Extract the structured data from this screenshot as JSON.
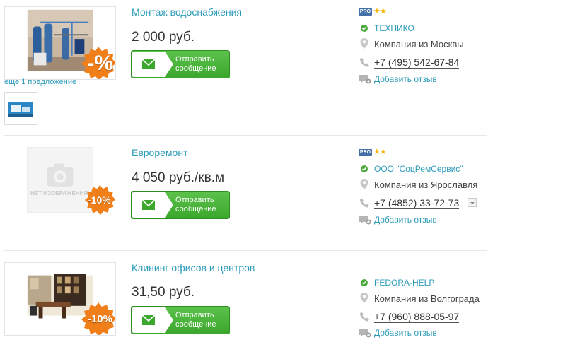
{
  "listings": [
    {
      "title": "Монтаж водоснабжения",
      "price": "2 000 руб.",
      "discount": "-%",
      "send_button": "Отправить\nсообщение",
      "more_offers": "еще 1 предложение",
      "pro_badge": "PRO",
      "company": "ТЕХНИКО",
      "city": "Компания из Москвы",
      "phone": "+7 (495) 542-67-84",
      "review_link": "Добавить отзыв"
    },
    {
      "title": "Евроремонт",
      "price": "4 050 руб./кв.м",
      "discount": "-10%",
      "no_image_text": "НЕТ ИЗОБРАЖЕНИЯ",
      "send_button": "Отправить\nсообщение",
      "pro_badge": "PRO",
      "company": "ООО \"СоцРемСервис\"",
      "city": "Компания из Ярославля",
      "phone": "+7 (4852) 33-72-73",
      "review_link": "Добавить отзыв"
    },
    {
      "title": "Клининг офисов и центров",
      "price": "31,50 руб.",
      "discount": "-10%",
      "send_button": "Отправить\nсообщение",
      "company": "FEDORA-HELP",
      "city": "Компания из Волгограда",
      "phone": "+7 (960) 888-05-97",
      "review_link": "Добавить отзыв"
    }
  ],
  "colors": {
    "link": "#2b9bb8",
    "button_green": "#3ba72c",
    "discount_orange": "#f07f1a",
    "verified_green": "#4aa83a",
    "star": "#f2b400",
    "pro_blue": "#4470a8"
  },
  "icons": [
    "envelope-icon",
    "verified-check-icon",
    "location-pin-icon",
    "phone-icon",
    "review-bubble-icon",
    "star-icon",
    "dropdown-arrow-icon"
  ]
}
